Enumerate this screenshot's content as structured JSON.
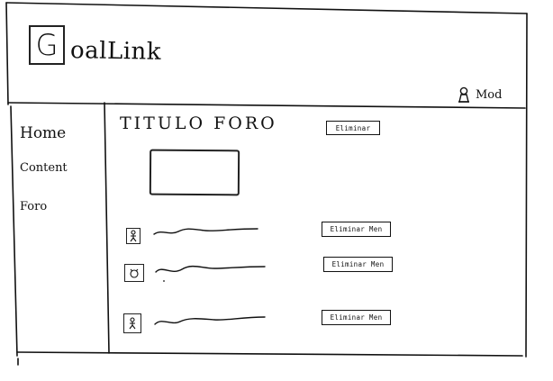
{
  "header": {
    "logo_letter": "G",
    "logo_rest": "oalLink",
    "user_label": "Mod",
    "user_icon": "user-icon"
  },
  "sidebar": {
    "items": [
      {
        "label": "Home"
      },
      {
        "label": "Content"
      },
      {
        "label": "Foro"
      }
    ]
  },
  "forum": {
    "title": "TITULO FORO",
    "delete_label": "Eliminar",
    "messages": [
      {
        "avatar_icon": "person-icon",
        "delete_label": "Eliminar Men"
      },
      {
        "avatar_icon": "face-icon",
        "delete_label": "Eliminar Men"
      },
      {
        "avatar_icon": "person-icon",
        "delete_label": "Eliminar Men"
      }
    ]
  },
  "colors": {
    "ink": "#111111",
    "background": "#ffffff"
  }
}
